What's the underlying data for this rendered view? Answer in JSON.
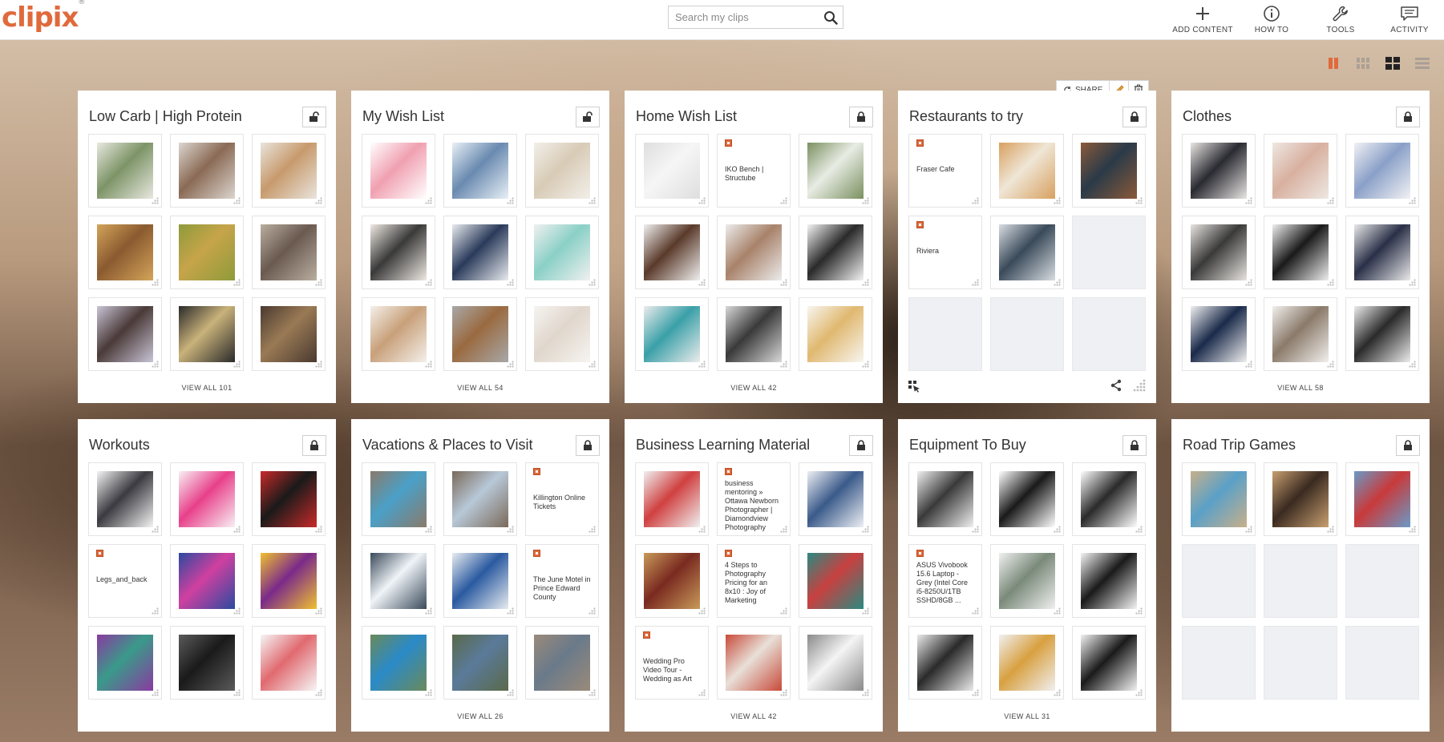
{
  "header": {
    "logo": "clipix",
    "logo_mark": "®",
    "search_placeholder": "Search my clips",
    "nav": [
      {
        "id": "add",
        "label": "ADD CONTENT",
        "icon": "plus-icon"
      },
      {
        "id": "howto",
        "label": "HOW TO",
        "icon": "info-icon"
      },
      {
        "id": "tools",
        "label": "TOOLS",
        "icon": "wrench-icon"
      },
      {
        "id": "activity",
        "label": "ACTIVITY",
        "icon": "message-icon"
      }
    ]
  },
  "view_toggles": [
    "large-grid-icon",
    "medium-grid-icon",
    "small-grid-icon",
    "list-icon"
  ],
  "accent_color": "#e06a3c",
  "hover_toolbar": {
    "share_label": "SHARE"
  },
  "boards": [
    {
      "title": "Low Carb | High Protein",
      "view_all": "VIEW ALL 101",
      "lock": "unlocked",
      "tiles": [
        {
          "type": "img",
          "c1": "#7d9467",
          "c2": "#e8e8e0"
        },
        {
          "type": "img",
          "c1": "#8a6a55",
          "c2": "#dcd6cf"
        },
        {
          "type": "img",
          "c1": "#c79a6c",
          "c2": "#e9e4dd"
        },
        {
          "type": "img",
          "c1": "#8a5a30",
          "c2": "#d4a45a"
        },
        {
          "type": "img",
          "c1": "#c7a44a",
          "c2": "#8e9b3a"
        },
        {
          "type": "img",
          "c1": "#6a5a50",
          "c2": "#b9aea0"
        },
        {
          "type": "img",
          "c1": "#4a3a38",
          "c2": "#c9c4d6"
        },
        {
          "type": "img",
          "c1": "#c9b27a",
          "c2": "#2a2a2a"
        },
        {
          "type": "img",
          "c1": "#9a7a55",
          "c2": "#4a3a30"
        }
      ]
    },
    {
      "title": "My Wish List",
      "view_all": "VIEW ALL 54",
      "lock": "unlocked",
      "tiles": [
        {
          "type": "img",
          "c1": "#f0a0b0",
          "c2": "#ffffff"
        },
        {
          "type": "img",
          "c1": "#6a8ab0",
          "c2": "#e8f0f6"
        },
        {
          "type": "img",
          "c1": "#d8cbb6",
          "c2": "#f2efe9"
        },
        {
          "type": "img",
          "c1": "#3a3a3a",
          "c2": "#efe9e3"
        },
        {
          "type": "img",
          "c1": "#2a3a5a",
          "c2": "#e9ecef"
        },
        {
          "type": "img",
          "c1": "#8ad0c6",
          "c2": "#f0f0f0"
        },
        {
          "type": "img",
          "c1": "#c8a07a",
          "c2": "#f4f0ea"
        },
        {
          "type": "img",
          "c1": "#9a6a40",
          "c2": "#a8a8a8"
        },
        {
          "type": "img",
          "c1": "#e0d6cc",
          "c2": "#f6f4f1"
        }
      ]
    },
    {
      "title": "Home Wish List",
      "view_all": "VIEW ALL 42",
      "lock": "locked",
      "tiles": [
        {
          "type": "img",
          "c1": "#f6f6f6",
          "c2": "#dedede"
        },
        {
          "type": "note",
          "text": "IKO Bench | Structube"
        },
        {
          "type": "img",
          "c1": "#e8ece4",
          "c2": "#7a9060"
        },
        {
          "type": "img",
          "c1": "#5a3a2a",
          "c2": "#f0f0f0"
        },
        {
          "type": "img",
          "c1": "#a8826a",
          "c2": "#ececec"
        },
        {
          "type": "img",
          "c1": "#2a2a2a",
          "c2": "#f4f4f4"
        },
        {
          "type": "img",
          "c1": "#3aa0a8",
          "c2": "#ececec"
        },
        {
          "type": "img",
          "c1": "#3a3a3a",
          "c2": "#d8d8d8"
        },
        {
          "type": "img",
          "c1": "#e0b870",
          "c2": "#f8f6f0"
        }
      ]
    },
    {
      "title": "Restaurants to try",
      "view_all": "",
      "lock": "locked",
      "tiles": [
        {
          "type": "note",
          "text": "Fraser Cafe"
        },
        {
          "type": "img",
          "c1": "#efe6d6",
          "c2": "#d8a060"
        },
        {
          "type": "img",
          "c1": "#2a3a48",
          "c2": "#8a5a3a"
        },
        {
          "type": "note",
          "text": "Riviera"
        },
        {
          "type": "img",
          "c1": "#3a4a5a",
          "c2": "#d8dde2"
        },
        {
          "type": "empty"
        },
        {
          "type": "empty"
        },
        {
          "type": "empty"
        },
        {
          "type": "empty"
        }
      ]
    },
    {
      "title": "Clothes",
      "view_all": "VIEW ALL 58",
      "lock": "locked",
      "tiles": [
        {
          "type": "img",
          "c1": "#2a2a32",
          "c2": "#e9e6e3"
        },
        {
          "type": "img",
          "c1": "#d8b0a0",
          "c2": "#eee8e2"
        },
        {
          "type": "img",
          "c1": "#8aa0c8",
          "c2": "#f2f2f4"
        },
        {
          "type": "img",
          "c1": "#3a3a3a",
          "c2": "#e8e4e0"
        },
        {
          "type": "img",
          "c1": "#1a1a1a",
          "c2": "#efefef"
        },
        {
          "type": "img",
          "c1": "#2a3048",
          "c2": "#eaeaea"
        },
        {
          "type": "img",
          "c1": "#1a2a4a",
          "c2": "#f0f0f0"
        },
        {
          "type": "img",
          "c1": "#8a7a6a",
          "c2": "#f2f0ee"
        },
        {
          "type": "img",
          "c1": "#2a2a2a",
          "c2": "#ececec"
        }
      ]
    },
    {
      "title": "Workouts",
      "view_all": "",
      "lock": "locked",
      "tiles": [
        {
          "type": "img",
          "c1": "#3a3a40",
          "c2": "#f4f4f4"
        },
        {
          "type": "img",
          "c1": "#e8408a",
          "c2": "#f8f0f4"
        },
        {
          "type": "img",
          "c1": "#1a1a1a",
          "c2": "#c82a2a"
        },
        {
          "type": "note",
          "text": "Legs_and_back",
          "mid": true
        },
        {
          "type": "img",
          "c1": "#d040a0",
          "c2": "#2a4aa0"
        },
        {
          "type": "img",
          "c1": "#7a2a8a",
          "c2": "#f0c030"
        },
        {
          "type": "img",
          "c1": "#3a9a8a",
          "c2": "#8a3aa0"
        },
        {
          "type": "img",
          "c1": "#1a1a1a",
          "c2": "#5a5a5a"
        },
        {
          "type": "img",
          "c1": "#e06a70",
          "c2": "#f6f6f6"
        }
      ]
    },
    {
      "title": "Vacations & Places to Visit",
      "view_all": "VIEW ALL 26",
      "lock": "locked",
      "tiles": [
        {
          "type": "img",
          "c1": "#4aa0c8",
          "c2": "#8a7a6a"
        },
        {
          "type": "img",
          "c1": "#b8c8d8",
          "c2": "#7a6a5a"
        },
        {
          "type": "note",
          "text": "Killington Online Tickets"
        },
        {
          "type": "img",
          "c1": "#f0f4f8",
          "c2": "#3a4a5a"
        },
        {
          "type": "img",
          "c1": "#2a5aa0",
          "c2": "#e8ecf0"
        },
        {
          "type": "note",
          "text": "The June Motel in Prince Edward County"
        },
        {
          "type": "img",
          "c1": "#2a8ac8",
          "c2": "#6a8a5a"
        },
        {
          "type": "img",
          "c1": "#5a7a9a",
          "c2": "#5a6a4a"
        },
        {
          "type": "img",
          "c1": "#6a7a8a",
          "c2": "#9a8a7a"
        }
      ]
    },
    {
      "title": "Business Learning Material",
      "view_all": "VIEW ALL 42",
      "lock": "locked",
      "tiles": [
        {
          "type": "img",
          "c1": "#d04040",
          "c2": "#f0f0f0"
        },
        {
          "type": "note",
          "text": "business mentoring » Ottawa Newborn Photographer | Diamondview Photography",
          "top": true
        },
        {
          "type": "img",
          "c1": "#3a5a8a",
          "c2": "#eef0f4"
        },
        {
          "type": "img",
          "c1": "#7a2a20",
          "c2": "#c89a5a"
        },
        {
          "type": "note",
          "text": "4 Steps to Photography Pricing for an 8x10 : Joy of Marketing",
          "top": true
        },
        {
          "type": "img",
          "c1": "#c84040",
          "c2": "#2a8a80"
        },
        {
          "type": "note",
          "text": "Wedding Pro Video Tour - Wedding as Art"
        },
        {
          "type": "img",
          "c1": "#e8e0d8",
          "c2": "#c84a3a"
        },
        {
          "type": "img",
          "c1": "#f4f4f4",
          "c2": "#8a8a8a"
        }
      ]
    },
    {
      "title": "Equipment To Buy",
      "view_all": "VIEW ALL 31",
      "lock": "locked",
      "tiles": [
        {
          "type": "img",
          "c1": "#3a3a3a",
          "c2": "#f0f0f0"
        },
        {
          "type": "img",
          "c1": "#1a1a1a",
          "c2": "#ffffff"
        },
        {
          "type": "img",
          "c1": "#2a2a2a",
          "c2": "#ffffff"
        },
        {
          "type": "note",
          "text": "ASUS Vivobook 15.6 Laptop - Grey (Intel Core i5-8250U/1TB SSHD/8GB ...",
          "top": true
        },
        {
          "type": "img",
          "c1": "#7a8a7a",
          "c2": "#f0f0f0"
        },
        {
          "type": "img",
          "c1": "#1a1a1a",
          "c2": "#f4f4f4"
        },
        {
          "type": "img",
          "c1": "#2a2a2a",
          "c2": "#eaeaea"
        },
        {
          "type": "img",
          "c1": "#d8a040",
          "c2": "#f0f0f0"
        },
        {
          "type": "img",
          "c1": "#1a1a1a",
          "c2": "#f2f2f2"
        }
      ]
    },
    {
      "title": "Road Trip Games",
      "view_all": "",
      "lock": "locked",
      "tiles": [
        {
          "type": "img",
          "c1": "#5aa0c8",
          "c2": "#c8b08a"
        },
        {
          "type": "img",
          "c1": "#3a2a20",
          "c2": "#c8a070"
        },
        {
          "type": "img",
          "c1": "#c83a3a",
          "c2": "#6a9ac8"
        },
        {
          "type": "empty"
        },
        {
          "type": "empty"
        },
        {
          "type": "empty"
        },
        {
          "type": "empty"
        },
        {
          "type": "empty"
        },
        {
          "type": "empty"
        }
      ]
    }
  ]
}
